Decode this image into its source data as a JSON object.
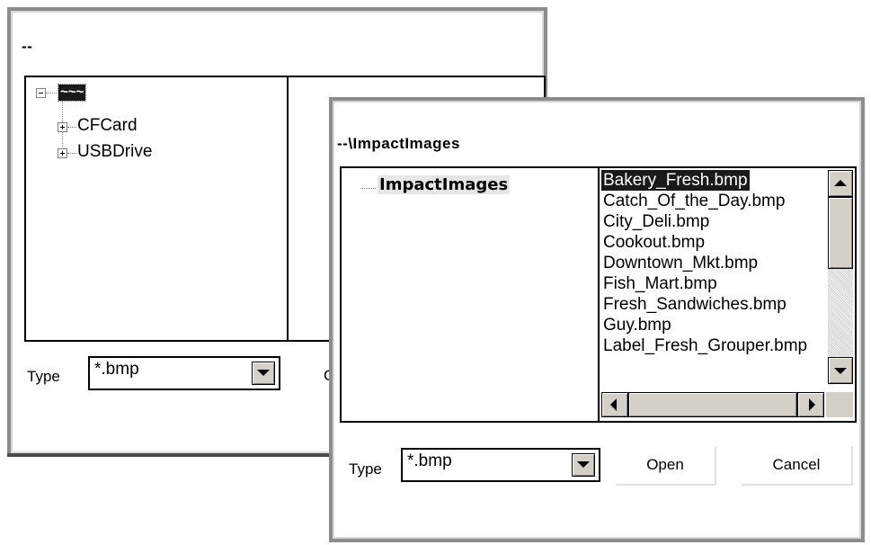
{
  "back_dialog": {
    "title": "--",
    "tree": {
      "root_label": "~~~",
      "items": [
        {
          "label": "CFCard"
        },
        {
          "label": "USBDrive"
        }
      ]
    },
    "type_label": "Type",
    "type_value": "*.bmp",
    "open_partial": "O"
  },
  "front_dialog": {
    "title": "--\\ImpactImages",
    "tree": {
      "selected_folder": "ImpactImages"
    },
    "files": [
      {
        "name": "Bakery_Fresh.bmp",
        "selected": true
      },
      {
        "name": "Catch_Of_the_Day.bmp",
        "selected": false
      },
      {
        "name": "City_Deli.bmp",
        "selected": false
      },
      {
        "name": "Cookout.bmp",
        "selected": false
      },
      {
        "name": "Downtown_Mkt.bmp",
        "selected": false
      },
      {
        "name": "Fish_Mart.bmp",
        "selected": false
      },
      {
        "name": "Fresh_Sandwiches.bmp",
        "selected": false
      },
      {
        "name": "Guy.bmp",
        "selected": false
      },
      {
        "name": "Label_Fresh_Grouper.bmp",
        "selected": false
      }
    ],
    "type_label": "Type",
    "type_value": "*.bmp",
    "open_label": "Open",
    "cancel_label": "Cancel"
  },
  "colors": {
    "window_border": "#8c8c8c",
    "selection_bg": "#1a1a1a",
    "scrollbar_face": "#d4d0c8"
  }
}
